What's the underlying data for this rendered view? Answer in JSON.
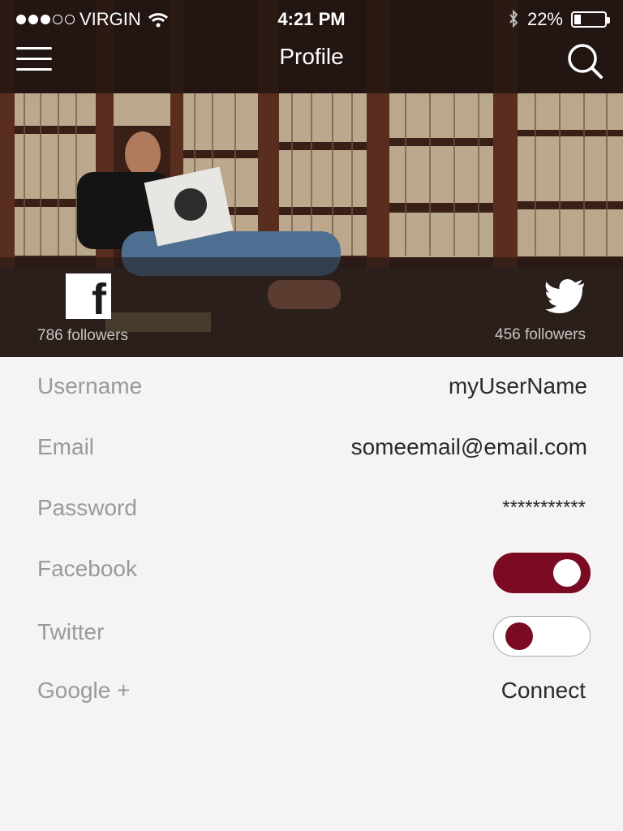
{
  "status": {
    "carrier": "VIRGIN",
    "time": "4:21 PM",
    "battery": "22%",
    "battery_level": 0.22
  },
  "nav": {
    "title": "Profile"
  },
  "social": {
    "facebook_followers": "786 followers",
    "twitter_followers": "456 followers"
  },
  "form": {
    "username_label": "Username",
    "username_value": "myUserName",
    "email_label": "Email",
    "email_value": "someemail@email.com",
    "password_label": "Password",
    "password_value": "***********",
    "facebook_label": "Facebook",
    "facebook_enabled": true,
    "twitter_label": "Twitter",
    "twitter_enabled": false,
    "google_label": "Google +",
    "google_action": "Connect"
  },
  "colors": {
    "accent": "#7a0b22",
    "label": "#9a9a9a",
    "background": "#f5f3f3"
  }
}
